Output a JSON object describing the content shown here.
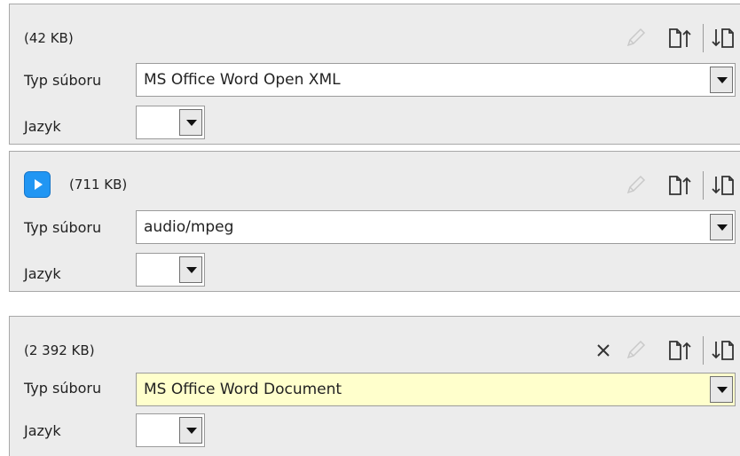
{
  "attachments": [
    {
      "size": "(42 KB)",
      "file_type_label": "Typ súboru",
      "file_type_value": "MS Office Word Open XML",
      "language_label": "Jazyk",
      "language_value": "",
      "has_play": false,
      "has_close": false
    },
    {
      "size": "(711 KB)",
      "file_type_label": "Typ súboru",
      "file_type_value": "audio/mpeg",
      "language_label": "Jazyk",
      "language_value": "",
      "has_play": true,
      "has_close": false
    },
    {
      "size": "(2 392 KB)",
      "file_type_label": "Typ súboru",
      "file_type_value": "MS Office Word Document",
      "language_label": "Jazyk",
      "language_value": "",
      "has_play": false,
      "has_close": true
    }
  ],
  "icons": {
    "play": "play-icon",
    "edit": "pencil-icon",
    "upload": "file-upload-icon",
    "download": "file-download-icon",
    "close": "close-icon",
    "dropdown": "triangle-down-icon"
  },
  "colors": {
    "panel_bg": "#ececec",
    "panel_border": "#a8a8a8",
    "play_button": "#2196f3",
    "highlight_select": "#ffffcc",
    "disabled_icon": "#c9c9c9"
  }
}
